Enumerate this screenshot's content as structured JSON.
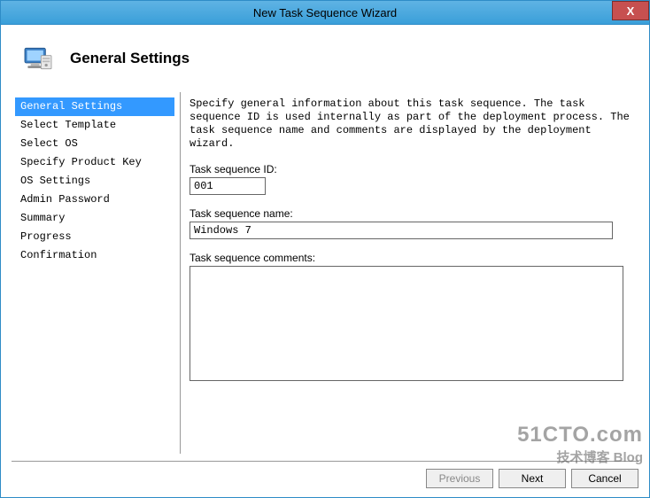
{
  "titlebar": {
    "title": "New Task Sequence Wizard",
    "close": "X"
  },
  "header": {
    "page_title": "General Settings"
  },
  "sidebar": {
    "items": [
      {
        "label": "General Settings",
        "selected": true
      },
      {
        "label": "Select Template",
        "selected": false
      },
      {
        "label": "Select OS",
        "selected": false
      },
      {
        "label": "Specify Product Key",
        "selected": false
      },
      {
        "label": "OS Settings",
        "selected": false
      },
      {
        "label": "Admin Password",
        "selected": false
      },
      {
        "label": "Summary",
        "selected": false
      },
      {
        "label": "Progress",
        "selected": false
      },
      {
        "label": "Confirmation",
        "selected": false
      }
    ]
  },
  "main": {
    "description": "Specify general information about this task sequence.  The task sequence ID is used internally as part of the deployment process.  The task sequence name and comments are displayed by the deployment wizard.",
    "id_label": "Task sequence ID:",
    "id_value": "001",
    "name_label": "Task sequence name:",
    "name_value": "Windows 7",
    "comments_label": "Task sequence comments:",
    "comments_value": ""
  },
  "footer": {
    "previous": "Previous",
    "next": "Next",
    "cancel": "Cancel"
  },
  "watermark": {
    "line1": "51CTO.com",
    "line2": "技术博客 Blog"
  }
}
